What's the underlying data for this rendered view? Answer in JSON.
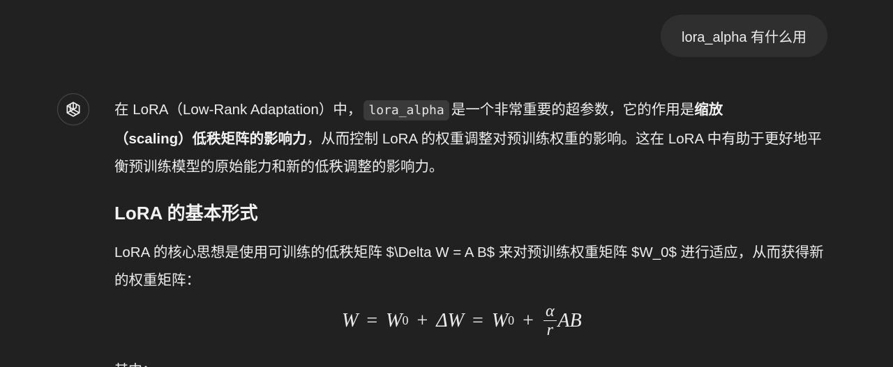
{
  "user_message": "lora_alpha 有什么用",
  "assistant_avatar_icon": "openai-logo-icon",
  "para1": {
    "t1": "在 LoRA（Low-Rank Adaptation）中，",
    "code": "lora_alpha",
    "t2": "是一个非常重要的超参数，它的作用是",
    "bold1": "缩放",
    "bold2": "（scaling）低秩矩阵的影响力",
    "t3": "，从而控制 LoRA 的权重调整对预训练权重的影响。这在 LoRA 中有助于更好地平衡预训练模型的原始能力和新的低秩调整的影响力。"
  },
  "heading": "LoRA 的基本形式",
  "para2": "LoRA 的核心思想是使用可训练的低秩矩阵 $\\Delta W = A B$ 来对预训练权重矩阵 $W_0$ 进行适应，从而获得新的权重矩阵：",
  "formula": {
    "w": "W",
    "eq": "=",
    "w0": "W",
    "sub0": "0",
    "plus": "+",
    "delta": "ΔW",
    "eq2": "=",
    "w0b": "W",
    "sub0b": "0",
    "plus2": "+",
    "alpha": "α",
    "r": "r",
    "ab": "AB"
  },
  "cut_text": "其中："
}
